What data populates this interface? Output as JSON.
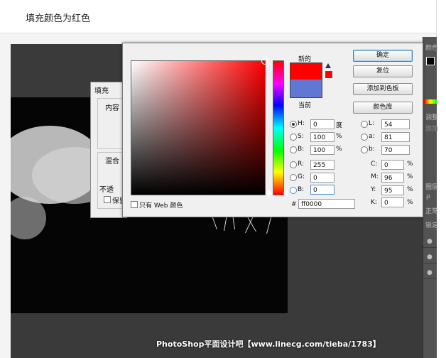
{
  "caption": {
    "text": "填充颜色为红色"
  },
  "fill_dialog": {
    "title": "填充",
    "content_label": "内容",
    "blend_label": "混合",
    "opacity_label": "不透",
    "preserve_label": "保留"
  },
  "right_panel": {
    "color_label": "颜色",
    "adjust_label": "调整",
    "add_label": "添加",
    "layers_label": "图层",
    "search_label": "ρ",
    "mode_label": "正常",
    "lock_label": "锁定"
  },
  "picker": {
    "new_label": "新的",
    "current_label": "当前",
    "new_color": "#ff0000",
    "current_color": "#6077d4",
    "buttons": {
      "ok": "确定",
      "reset": "复位",
      "add_swatch": "添加到色板",
      "libraries": "颜色库"
    },
    "web_only_label": "只有 Web 颜色",
    "fields": {
      "h": {
        "label": "H:",
        "value": "0",
        "unit": "度"
      },
      "s": {
        "label": "S:",
        "value": "100",
        "unit": "%"
      },
      "b": {
        "label": "B:",
        "value": "100",
        "unit": "%"
      },
      "r": {
        "label": "R:",
        "value": "255"
      },
      "g": {
        "label": "G:",
        "value": "0"
      },
      "bl": {
        "label": "B:",
        "value": "0"
      },
      "l": {
        "label": "L:",
        "value": "54"
      },
      "a": {
        "label": "a:",
        "value": "81"
      },
      "lb": {
        "label": "b:",
        "value": "70"
      },
      "c": {
        "label": "C:",
        "value": "0",
        "unit": "%"
      },
      "m": {
        "label": "M:",
        "value": "96",
        "unit": "%"
      },
      "y": {
        "label": "Y:",
        "value": "95",
        "unit": "%"
      },
      "k": {
        "label": "K:",
        "value": "0",
        "unit": "%"
      },
      "hex": {
        "label": "#",
        "value": "ff0000"
      }
    }
  },
  "watermark": {
    "text": "PhotoShop平面设计吧【www.linecg.com/tieba/1783】"
  }
}
